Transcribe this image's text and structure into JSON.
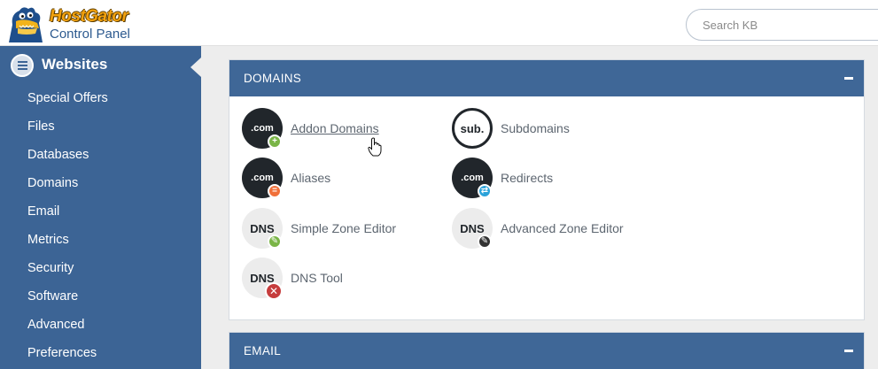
{
  "header": {
    "brand": "HostGator",
    "subtitle": "Control Panel",
    "search_placeholder": "Search KB"
  },
  "sidebar": {
    "title": "Websites",
    "items": [
      {
        "label": "Special Offers"
      },
      {
        "label": "Files"
      },
      {
        "label": "Databases"
      },
      {
        "label": "Domains"
      },
      {
        "label": "Email"
      },
      {
        "label": "Metrics"
      },
      {
        "label": "Security"
      },
      {
        "label": "Software"
      },
      {
        "label": "Advanced"
      },
      {
        "label": "Preferences"
      }
    ]
  },
  "domains_panel": {
    "title": "DOMAINS",
    "collapse_icon": "minus-icon",
    "tools": [
      {
        "label": "Addon Domains",
        "badge": ".com",
        "mini": "+",
        "mini_color": "#7ab547"
      },
      {
        "label": "Subdomains",
        "badge": "sub."
      },
      {
        "label": "Aliases",
        "badge": ".com",
        "mini": "=",
        "mini_color": "#f0703a"
      },
      {
        "label": "Redirects",
        "badge": ".com",
        "mini": "⇄",
        "mini_color": "#2aa2d9"
      },
      {
        "label": "Simple Zone Editor",
        "badge": "DNS",
        "mini": "✎",
        "mini_color": "#7ab547"
      },
      {
        "label": "Advanced Zone Editor",
        "badge": "DNS",
        "mini": "✎",
        "mini_color": "#333333"
      },
      {
        "label": "DNS Tool",
        "badge": "DNS",
        "mini": "✕",
        "mini_color": "#c63d3d"
      }
    ]
  },
  "email_panel": {
    "title": "EMAIL",
    "collapse_icon": "minus-icon"
  },
  "colors": {
    "sidebar_bg": "#3c6495",
    "panel_header_bg": "#3f6797",
    "page_bg": "#ededed"
  }
}
